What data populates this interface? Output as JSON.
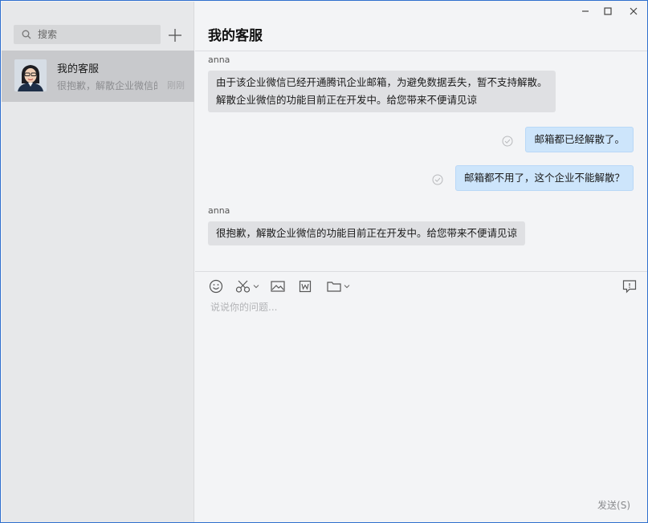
{
  "window": {
    "minimize_icon": "minimize-icon",
    "maximize_icon": "maximize-icon",
    "close_icon": "close-icon"
  },
  "sidebar": {
    "search_placeholder": "搜索",
    "add_icon": "plus-icon",
    "conversations": [
      {
        "name": "我的客服",
        "preview": "很抱歉，解散企业微信的功能目前正在开发中。给您带来不便请见谅",
        "time": "刚刚"
      }
    ]
  },
  "chat": {
    "title": "我的客服",
    "messages": [
      {
        "sender": "anna",
        "side": "left",
        "lines": [
          "由于该企业微信已经开通腾讯企业邮箱，为避免数据丢失，暂不支持解散。",
          "解散企业微信的功能目前正在开发中。给您带来不便请见谅"
        ]
      },
      {
        "side": "right",
        "text": "邮箱都已经解散了。"
      },
      {
        "side": "right",
        "text": "邮箱都不用了，这个企业不能解散？"
      },
      {
        "sender": "anna",
        "side": "left",
        "lines": [
          "很抱歉，解散企业微信的功能目前正在开发中。给您带来不便请见谅"
        ]
      }
    ]
  },
  "composer": {
    "placeholder": "说说你的问题...",
    "send_label": "发送(S)",
    "tools": [
      "emoji-icon",
      "screenshot-icon",
      "image-icon",
      "word-doc-icon",
      "folder-icon",
      "feedback-icon"
    ]
  },
  "colors": {
    "accent_border": "#2f6fce",
    "own_bubble": "#cde5fb",
    "other_bubble": "#dfe0e3",
    "sidebar_bg": "#e7e8ea",
    "selected_item": "#c8c9cc"
  }
}
